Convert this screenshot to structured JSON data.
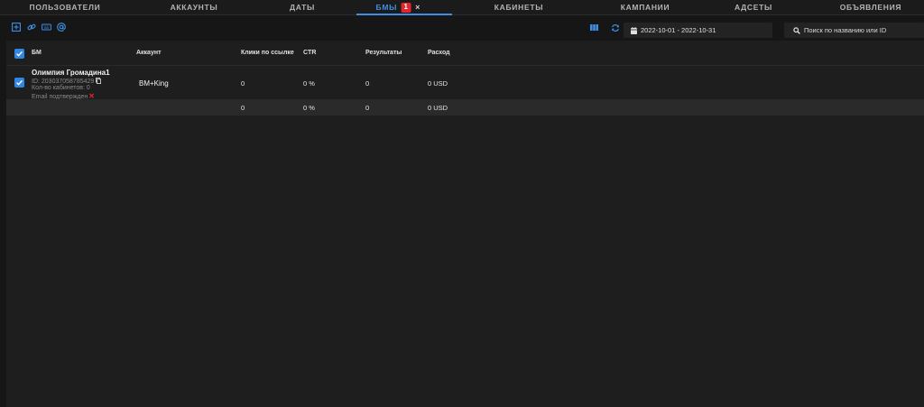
{
  "tabs": [
    {
      "label": "ПОЛЬЗОВАТЕЛИ"
    },
    {
      "label": "АККАУНТЫ"
    },
    {
      "label": "ДАТЫ"
    },
    {
      "label": "БМЫ",
      "badge": "1",
      "close": "×",
      "active": true
    },
    {
      "label": "КАБИНЕТЫ"
    },
    {
      "label": "КАМПАНИИ"
    },
    {
      "label": "АДСЕТЫ"
    },
    {
      "label": "ОБЪЯВЛЕНИЯ"
    }
  ],
  "toolbar": {
    "date_range": "2022-10-01 - 2022-10-31",
    "search_placeholder": "Поиск по названию или ID",
    "icons": [
      "add-icon",
      "link-icon",
      "keyboard-icon",
      "at-sign-icon",
      "columns-icon",
      "refresh-icon",
      "calendar-icon",
      "search-icon"
    ]
  },
  "colors": {
    "accent": "#3d8fe6",
    "badge": "#e0282c",
    "background": "#161616",
    "table_bg": "#1e1e1e",
    "total_row": "#2a2a2a"
  },
  "table": {
    "headers": {
      "bm": "БМ",
      "account": "Аккаунт",
      "clicks": "Клики по ссылке",
      "ctr": "CTR",
      "results": "Результаты",
      "spend": "Расход"
    },
    "rows": [
      {
        "name": "Олимпия Громадина1",
        "id_text": "ID: 203037058785429",
        "cabinets": "Кол-во кабинетов: 0",
        "email": "Email подтвержден",
        "email_status": "✕",
        "account": "BM+King",
        "clicks": "0",
        "ctr": "0 %",
        "results": "0",
        "spend": "0 USD"
      }
    ],
    "totals": {
      "clicks": "0",
      "ctr": "0 %",
      "results": "0",
      "spend": "0 USD"
    }
  }
}
